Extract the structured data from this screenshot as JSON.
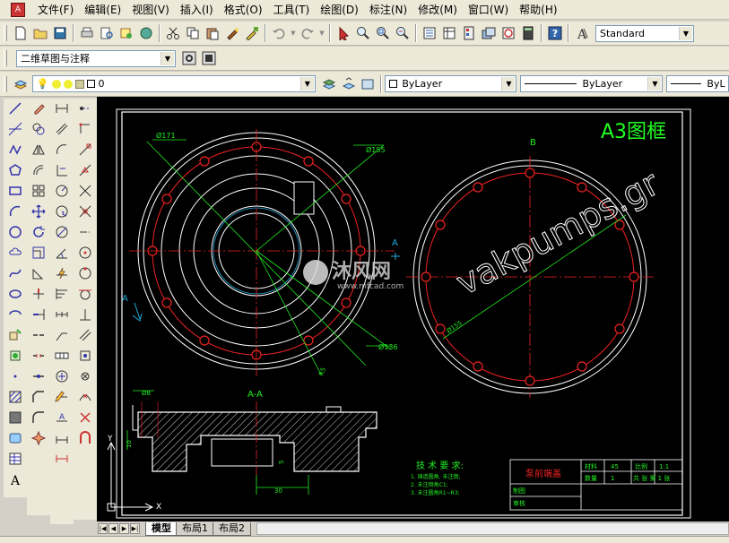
{
  "menubar": {
    "items": [
      "文件(F)",
      "编辑(E)",
      "视图(V)",
      "插入(I)",
      "格式(O)",
      "工具(T)",
      "绘图(D)",
      "标注(N)",
      "修改(M)",
      "窗口(W)",
      "帮助(H)"
    ]
  },
  "toolbar": {
    "text_style": "Standard",
    "workspace": "二维草图与注释",
    "layer": "0",
    "color": "ByLayer",
    "linetype": "ByLayer",
    "lineweight": "ByL"
  },
  "drawing": {
    "frame_title": "A3图框",
    "label_b": "B",
    "label_a": "A",
    "label_a_small": "A",
    "section_label": "A-A",
    "dim_171": "Ø171",
    "dim_155": "Ø155",
    "dim_136": "Ø136",
    "dim_155b": "Ø155",
    "dim_r": "R5",
    "dim_8": "Ø8",
    "dim_30": "30",
    "dim_10": "10",
    "dim_5": "5",
    "watermark_text": "vakpumps.gr",
    "logo_cn": "沐风网",
    "logo_url": "www.mfcad.com",
    "axis_y": "Y",
    "axis_x": "X",
    "tech_title": "技 术 要 求:",
    "tech_lines": [
      "1. 铸造圆角, 未注倒;",
      "2. 未注倒角C1;",
      "3. 未注圆角R1~R3;"
    ],
    "title_block": {
      "part_name": "泵前端盖",
      "material_label": "材料",
      "material": "45",
      "scale_label": "比例",
      "scale": "1:1",
      "qty_label": "数量",
      "qty": "1",
      "sheet": "共 张 第 1 张",
      "drawn": "制图",
      "checked": "审核"
    }
  },
  "tabs": [
    "模型",
    "布局1",
    "布局2"
  ]
}
